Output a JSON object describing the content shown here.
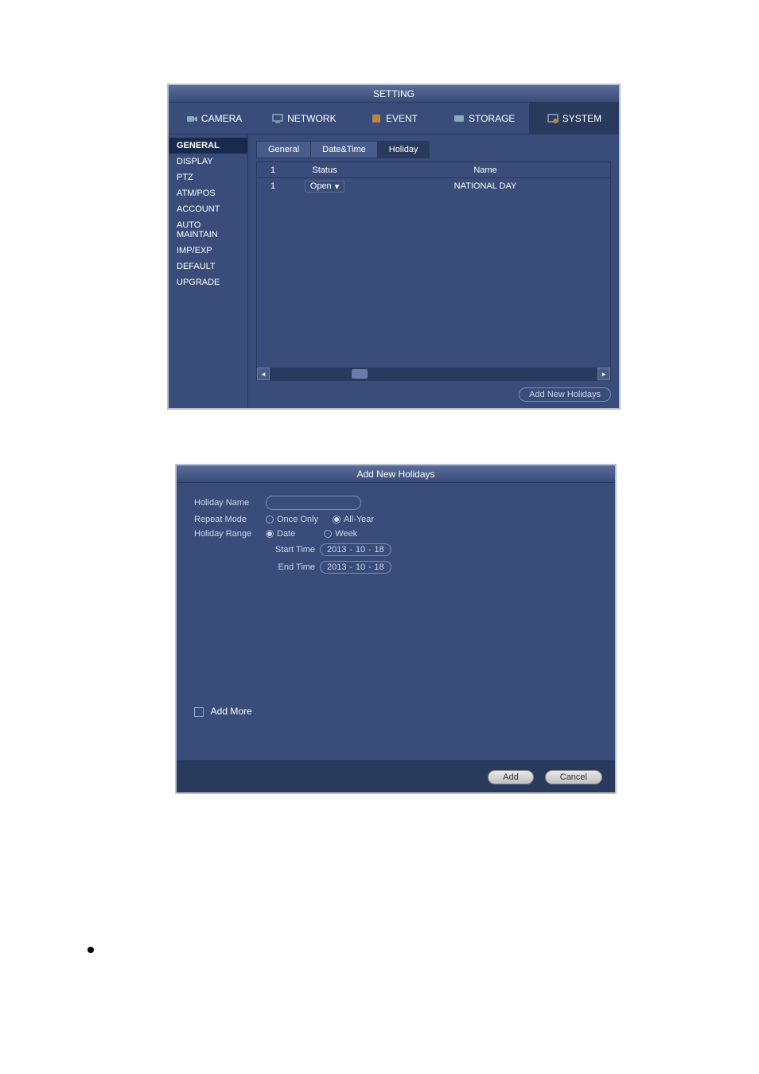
{
  "window1": {
    "title": "SETTING",
    "tabs": [
      "CAMERA",
      "NETWORK",
      "EVENT",
      "STORAGE",
      "SYSTEM"
    ],
    "active_tab": "SYSTEM",
    "sidebar": {
      "items": [
        "GENERAL",
        "DISPLAY",
        "PTZ",
        "ATM/POS",
        "ACCOUNT",
        "AUTO MAINTAIN",
        "IMP/EXP",
        "DEFAULT",
        "UPGRADE"
      ],
      "active": "GENERAL"
    },
    "sub_tabs": {
      "items": [
        "General",
        "Date&Time",
        "Holiday"
      ],
      "active": "Holiday"
    },
    "table": {
      "headers": {
        "count": "1",
        "status": "Status",
        "name": "Name"
      },
      "rows": [
        {
          "idx": "1",
          "status": "Open",
          "name": "NATIONAL DAY"
        }
      ]
    },
    "add_button": "Add New Holidays"
  },
  "window2": {
    "title": "Add New Holidays",
    "labels": {
      "holiday_name": "Holiday Name",
      "repeat_mode": "Repeat Mode",
      "once_only": "Once Only",
      "all_year": "All-Year",
      "holiday_range": "Holiday Range",
      "date": "Date",
      "week": "Week",
      "start_time": "Start Time",
      "end_time": "End Time",
      "add_more": "Add More"
    },
    "repeat_mode_selected": "All-Year",
    "holiday_range_selected": "Date",
    "start_time": {
      "y": "2013",
      "m": "10",
      "d": "18"
    },
    "end_time": {
      "y": "2013",
      "m": "10",
      "d": "18"
    },
    "buttons": {
      "add": "Add",
      "cancel": "Cancel"
    }
  }
}
